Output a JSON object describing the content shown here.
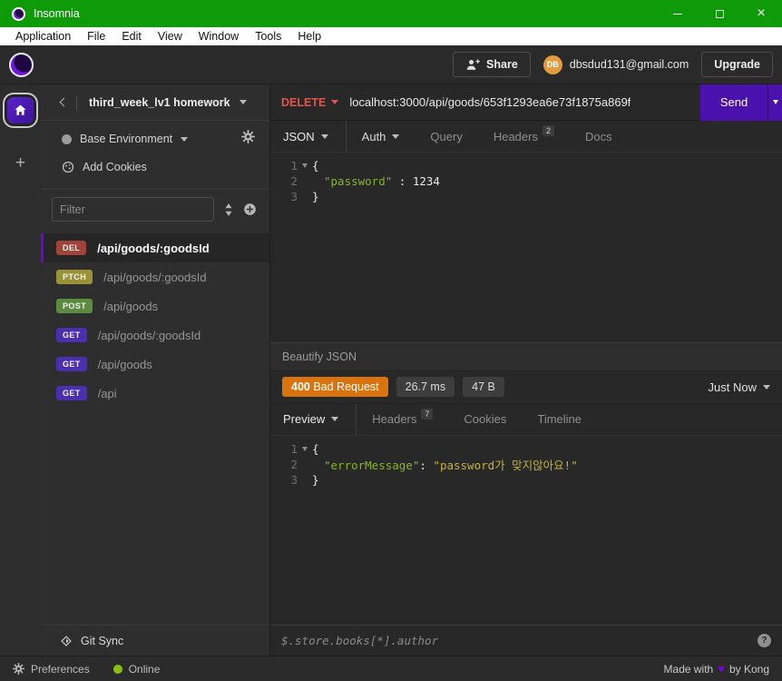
{
  "window": {
    "title": "Insomnia"
  },
  "icons": {
    "plus": "+",
    "close": "×",
    "heart": "♥",
    "help": "?"
  },
  "menu": {
    "items": [
      "Application",
      "File",
      "Edit",
      "View",
      "Window",
      "Tools",
      "Help"
    ]
  },
  "header": {
    "share_label": "Share",
    "avatar_initials": "DB",
    "account_email": "dbsdud131@gmail.com",
    "upgrade_label": "Upgrade",
    "avatar_color": "#e39b3d"
  },
  "sidebar": {
    "workspace_title": "third_week_lv1 homework",
    "environment_label": "Base Environment",
    "cookies_label": "Add Cookies",
    "filter_placeholder": "Filter",
    "requests": [
      {
        "method": "DEL",
        "path": "/api/goods/:goodsId",
        "color": "#9e4438",
        "active": true
      },
      {
        "method": "PTCH",
        "path": "/api/goods/:goodsId",
        "color": "#9a9336",
        "active": false
      },
      {
        "method": "POST",
        "path": "/api/goods",
        "color": "#5b8b3e",
        "active": false
      },
      {
        "method": "GET",
        "path": "/api/goods/:goodsId",
        "color": "#4a2fae",
        "active": false
      },
      {
        "method": "GET",
        "path": "/api/goods",
        "color": "#4a2fae",
        "active": false
      },
      {
        "method": "GET",
        "path": "/api",
        "color": "#4a2fae",
        "active": false
      }
    ],
    "git_sync_label": "Git Sync",
    "active_accent": "#7400e1"
  },
  "request": {
    "method": "DELETE",
    "method_color": "#e0564c",
    "url": "localhost:3000/api/goods/653f1293ea6e73f1875a869f",
    "send_label": "Send",
    "send_color": "#4b11ad",
    "tabs": [
      {
        "label": "JSON"
      },
      {
        "label": "Auth"
      },
      {
        "label": "Query"
      },
      {
        "label": "Headers",
        "badge": "2"
      },
      {
        "label": "Docs"
      }
    ],
    "body": {
      "line_numbers": [
        "1",
        "2",
        "3"
      ],
      "line1": "{",
      "line2_key": "\"password\"",
      "line2_sep": " : ",
      "line2_value": "1234",
      "line3": "}"
    },
    "beautify_label": "Beautify JSON"
  },
  "response": {
    "status_code": "400",
    "status_text": "Bad Request",
    "status_color": "#d9730d",
    "time": "26.7 ms",
    "size": "47 B",
    "history_label": "Just Now",
    "tabs": [
      {
        "label": "Preview"
      },
      {
        "label": "Headers",
        "badge": "7"
      },
      {
        "label": "Cookies"
      },
      {
        "label": "Timeline"
      }
    ],
    "body": {
      "line_numbers": [
        "1",
        "2",
        "3"
      ],
      "line1": "{",
      "line2_key": "\"errorMessage\"",
      "line2_sep": ": ",
      "line2_value": "\"password가 맞지않아요!\"",
      "line3": "}"
    }
  },
  "filter_bar": {
    "placeholder": "$.store.books[*].author"
  },
  "status_bar": {
    "preferences_label": "Preferences",
    "online_label": "Online",
    "online_color": "#84c212",
    "made_with": "Made with",
    "by": "by Kong"
  }
}
